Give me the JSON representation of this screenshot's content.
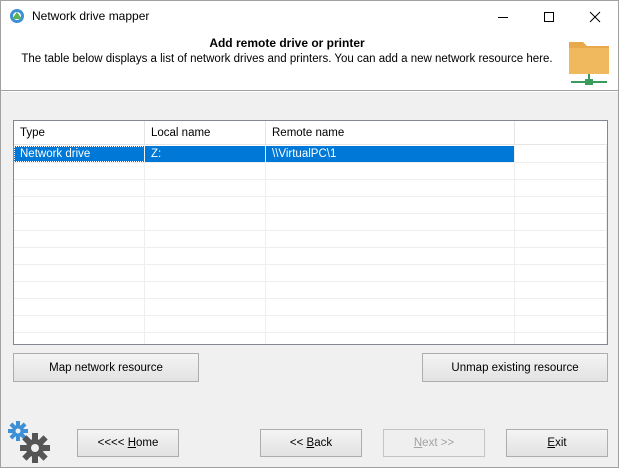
{
  "window": {
    "title": "Network drive mapper"
  },
  "header": {
    "title": "Add remote drive or printer",
    "description": "The table below displays a list of network drives and printers. You can add a new network resource here."
  },
  "table": {
    "columns": [
      "Type",
      "Local name",
      "Remote name",
      ""
    ],
    "rows": [
      {
        "type": "Network drive",
        "local": "Z:",
        "remote": "\\\\VirtualPC\\1",
        "selected": true
      }
    ]
  },
  "actions": {
    "map_label": "Map network resource",
    "unmap_label": "Unmap existing resource"
  },
  "nav": {
    "home_prefix": "<<<< ",
    "home_hotkey": "H",
    "home_rest": "ome",
    "back_prefix": "<< ",
    "back_hotkey": "B",
    "back_rest": "ack",
    "next_hotkey": "N",
    "next_rest": "ext >>",
    "exit_hotkey": "E",
    "exit_rest": "xit"
  },
  "colors": {
    "selection": "#0078d7",
    "folder": "#e8a94c",
    "network": "#3a9c5a"
  }
}
